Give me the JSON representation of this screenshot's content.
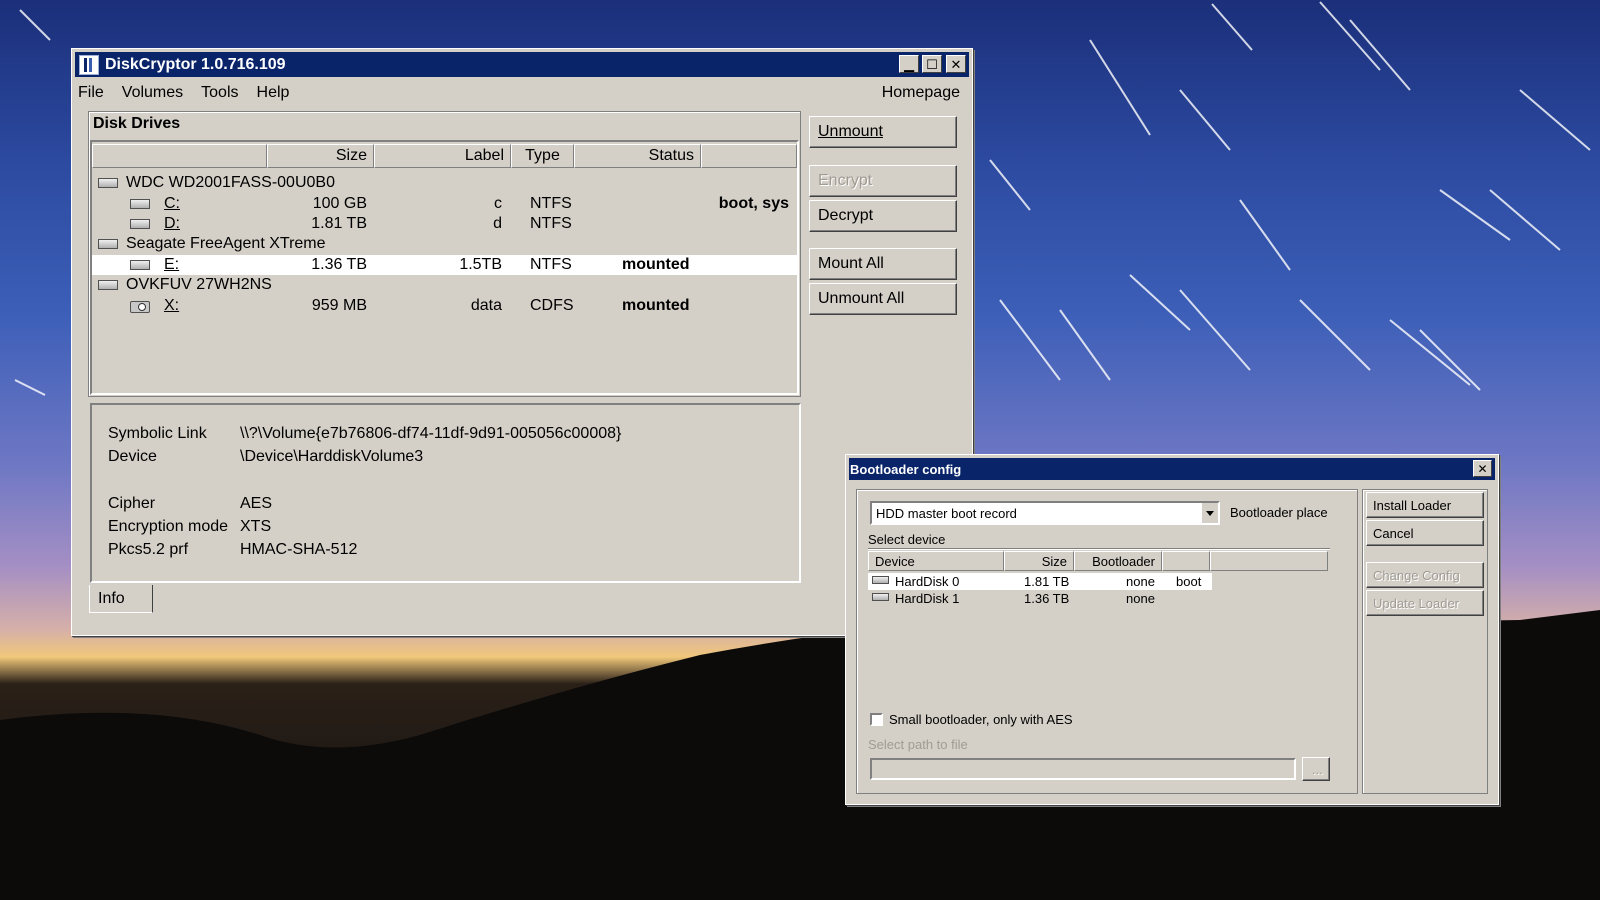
{
  "main_window": {
    "title": "DiskCryptor 1.0.716.109",
    "menu": [
      "File",
      "Volumes",
      "Tools",
      "Help"
    ],
    "homepage": "Homepage",
    "panel_title": "Disk Drives",
    "columns": [
      "Size",
      "Label",
      "Type",
      "Status"
    ],
    "drives": [
      {
        "kind": "disk",
        "name": "WDC WD2001FASS-00U0B0"
      },
      {
        "kind": "volume",
        "name": "C:",
        "size": "100 GB",
        "label": "c",
        "type": "NTFS",
        "status": "",
        "flags": "boot, sys"
      },
      {
        "kind": "volume",
        "name": "D:",
        "size": "1.81 TB",
        "label": "d",
        "type": "NTFS",
        "status": "",
        "flags": ""
      },
      {
        "kind": "disk",
        "name": "Seagate FreeAgent XTreme"
      },
      {
        "kind": "volume",
        "name": "E:",
        "size": "1.36 TB",
        "label": "1.5TB",
        "type": "NTFS",
        "status": "mounted",
        "flags": "",
        "selected": true
      },
      {
        "kind": "disk",
        "name": "OVKFUV 27WH2NS"
      },
      {
        "kind": "cdrom",
        "name": "X:",
        "size": "959 MB",
        "label": "data",
        "type": "CDFS",
        "status": "mounted",
        "flags": ""
      }
    ],
    "info": {
      "symbolic_link_label": "Symbolic Link",
      "symbolic_link": "\\\\?\\Volume{e7b76806-df74-11df-9d91-005056c00008}",
      "device_label": "Device",
      "device": "\\Device\\HarddiskVolume3",
      "cipher_label": "Cipher",
      "cipher": "AES",
      "mode_label": "Encryption mode",
      "mode": "XTS",
      "prf_label": "Pkcs5.2 prf",
      "prf": "HMAC-SHA-512"
    },
    "tab_info": "Info",
    "buttons": {
      "unmount": "Unmount",
      "encrypt": "Encrypt",
      "decrypt": "Decrypt",
      "mount_all": "Mount All",
      "unmount_all": "Unmount All"
    }
  },
  "bootloader": {
    "title": "Bootloader config",
    "place_value": "HDD master boot record",
    "place_label": "Bootloader place",
    "select_device": "Select device",
    "columns": [
      "Device",
      "Size",
      "Bootloader"
    ],
    "devices": [
      {
        "name": "HardDisk 0",
        "size": "1.81 TB",
        "bootloader": "none",
        "extra": "boot"
      },
      {
        "name": "HardDisk 1",
        "size": "1.36 TB",
        "bootloader": "none",
        "extra": ""
      }
    ],
    "small_bootloader": "Small bootloader, only with AES",
    "path_label": "Select path to file",
    "browse": "...",
    "buttons": {
      "install": "Install Loader",
      "cancel": "Cancel",
      "change_config": "Change Config",
      "update_loader": "Update Loader"
    }
  }
}
